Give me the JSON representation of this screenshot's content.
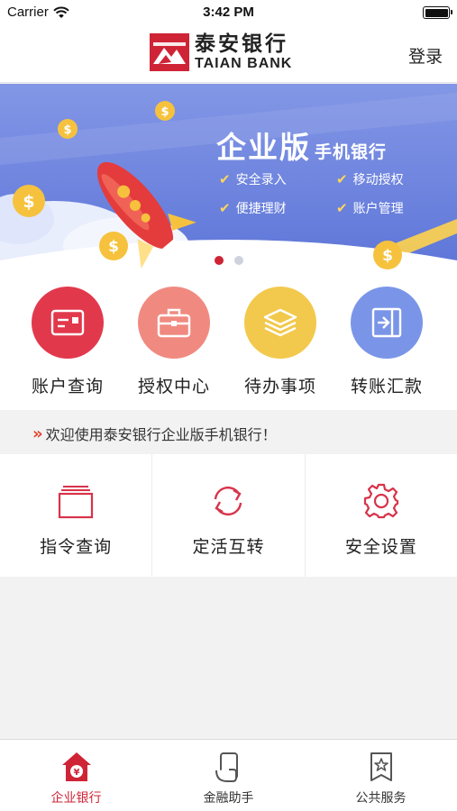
{
  "status_bar": {
    "carrier": "Carrier",
    "time": "3:42 PM"
  },
  "header": {
    "logo_cn": "泰安银行",
    "logo_en": "TAIAN BANK",
    "login_label": "登录"
  },
  "banner": {
    "title_main": "企业版",
    "title_sub": "手机银行",
    "features": [
      "安全录入",
      "移动授权",
      "便捷理财",
      "账户管理"
    ],
    "slide_count": 2,
    "active_slide": 1
  },
  "quick_actions": [
    {
      "label": "账户查询",
      "icon": "card-icon",
      "color": "#e2384c"
    },
    {
      "label": "授权中心",
      "icon": "briefcase-icon",
      "color": "#f08a80"
    },
    {
      "label": "待办事项",
      "icon": "layers-icon",
      "color": "#f2c94c"
    },
    {
      "label": "转账汇款",
      "icon": "transfer-in-icon",
      "color": "#7a95e8"
    }
  ],
  "notice": {
    "text": "欢迎使用泰安银行企业版手机银行！"
  },
  "tools": [
    {
      "label": "指令查询",
      "icon": "document-stack-icon"
    },
    {
      "label": "定活互转",
      "icon": "swap-arrows-icon"
    },
    {
      "label": "安全设置",
      "icon": "gear-icon"
    }
  ],
  "tabbar": [
    {
      "label": "企业银行",
      "icon": "home-yen-icon",
      "active": true
    },
    {
      "label": "金融助手",
      "icon": "phone-hand-icon",
      "active": false
    },
    {
      "label": "公共服务",
      "icon": "bookmark-star-icon",
      "active": false
    }
  ],
  "colors": {
    "brand_red": "#cf2436",
    "banner_blue": "#6f86e0"
  }
}
